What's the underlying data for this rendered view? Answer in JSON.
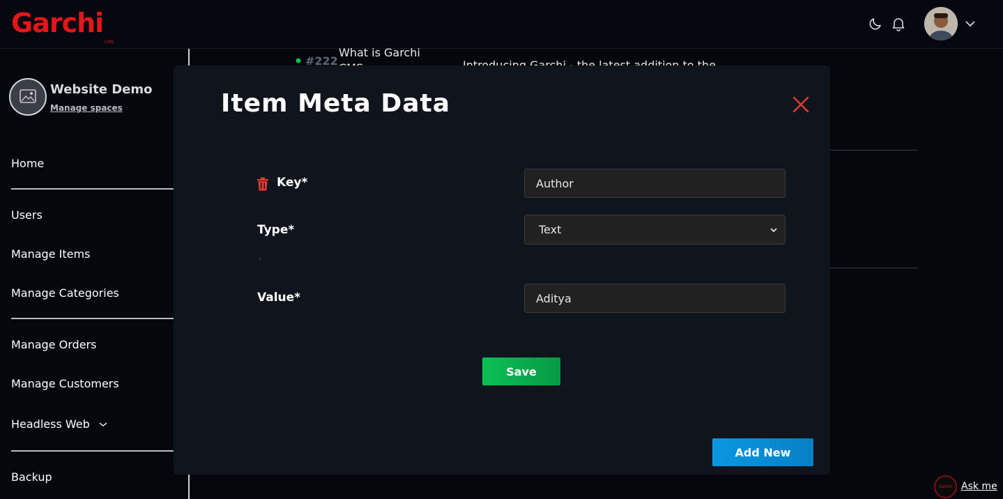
{
  "brand": {
    "logo": "Garchi",
    "logo_sub": "CMS",
    "accent": "#e3161b"
  },
  "header": {
    "icons": [
      "moon-icon",
      "bell-icon",
      "chevron-down-icon"
    ]
  },
  "sidebar": {
    "space_name": "Website Demo",
    "manage_spaces": "Manage spaces",
    "items": [
      {
        "label": "Home"
      },
      {
        "label": "Users"
      },
      {
        "label": "Manage Items"
      },
      {
        "label": "Manage Categories"
      },
      {
        "label": "Manage Orders"
      },
      {
        "label": "Manage Customers"
      },
      {
        "label": "Headless Web"
      },
      {
        "label": "Backup"
      }
    ]
  },
  "background": {
    "item_id": "#222",
    "item_title_line1": "What is Garchi",
    "item_title_line2": "CMS",
    "item_desc": "Introducing Garchi - the latest addition to the"
  },
  "modal": {
    "title": "Item Meta Data",
    "fields": {
      "key_label": "Key*",
      "key_value": "Author",
      "type_label": "Type*",
      "type_value": "Text",
      "value_label": "Value*",
      "value_value": "Aditya"
    },
    "save_label": "Save",
    "add_new_label": "Add New",
    "colors": {
      "save": "#0bbf55",
      "add_new": "#0a98e2",
      "close": "#e53935",
      "trash": "#e53935"
    }
  },
  "assistant": {
    "logo_text": "Garchi",
    "label": "Ask me"
  }
}
